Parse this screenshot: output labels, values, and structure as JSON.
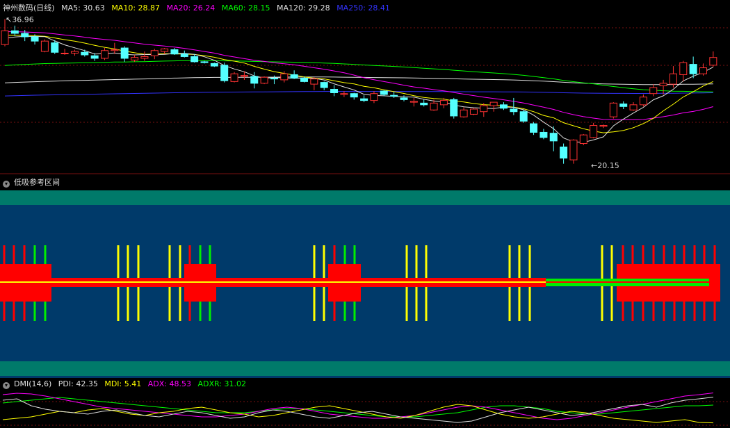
{
  "panel1": {
    "title": "神州数码(日线)",
    "indicators": [
      {
        "label": "MA5: 30.63",
        "color": "#e0e0e0"
      },
      {
        "label": "MA10: 28.87",
        "color": "#ffff00"
      },
      {
        "label": "MA20: 26.24",
        "color": "#ff00ff"
      },
      {
        "label": "MA60: 28.15",
        "color": "#00ff00"
      },
      {
        "label": "MA120: 29.28",
        "color": "#e0e0e0"
      },
      {
        "label": "MA250: 28.41",
        "color": "#3333ff"
      }
    ],
    "high_label": "36.96",
    "low_label": "20.15"
  },
  "panel2": {
    "title": "低吸参考区间"
  },
  "panel3": {
    "title": "DMI(14,6)",
    "indicators": [
      {
        "label": "PDI: 42.35",
        "color": "#e0e0e0"
      },
      {
        "label": "MDI: 5.41",
        "color": "#ffff00"
      },
      {
        "label": "ADX: 48.53",
        "color": "#ff00ff"
      },
      {
        "label": "ADXR: 31.02",
        "color": "#00ff00"
      }
    ]
  },
  "colors": {
    "up": "#ff3232",
    "down": "#54ffff",
    "grid": "#7a1010",
    "teal": "#007a6a",
    "navy": "#003a6a",
    "red": "#ff0000",
    "yellow": "#ffff00",
    "green": "#00ee00"
  },
  "chart_data": {
    "type": "candlestick",
    "candles": [
      [
        34.0,
        36.96,
        33.8,
        35.6
      ],
      [
        35.6,
        36.2,
        35.0,
        35.3
      ],
      [
        35.3,
        35.7,
        34.4,
        34.9
      ],
      [
        34.9,
        35.2,
        34.0,
        34.4
      ],
      [
        33.2,
        34.6,
        33.1,
        34.4
      ],
      [
        34.2,
        34.5,
        32.9,
        33.1
      ],
      [
        33.0,
        33.5,
        32.8,
        33.0
      ],
      [
        33.0,
        33.4,
        32.7,
        33.2
      ],
      [
        33.1,
        33.4,
        32.6,
        32.8
      ],
      [
        32.7,
        33.0,
        32.1,
        32.4
      ],
      [
        32.4,
        33.6,
        32.2,
        33.3
      ],
      [
        33.3,
        34.2,
        32.9,
        33.4
      ],
      [
        33.6,
        33.8,
        32.0,
        32.4
      ],
      [
        32.2,
        32.8,
        32.0,
        32.5
      ],
      [
        32.4,
        33.2,
        32.1,
        32.6
      ],
      [
        32.7,
        33.5,
        32.3,
        33.3
      ],
      [
        33.2,
        33.6,
        32.9,
        33.5
      ],
      [
        33.4,
        33.6,
        32.8,
        32.9
      ],
      [
        32.9,
        33.3,
        32.5,
        32.6
      ],
      [
        32.6,
        32.9,
        31.9,
        32.0
      ],
      [
        32.0,
        32.1,
        31.8,
        31.9
      ],
      [
        31.8,
        31.9,
        31.4,
        31.5
      ],
      [
        31.6,
        31.9,
        29.6,
        29.8
      ],
      [
        29.7,
        30.8,
        29.6,
        30.6
      ],
      [
        30.4,
        30.9,
        29.9,
        30.4
      ],
      [
        30.3,
        30.8,
        28.9,
        29.5
      ],
      [
        29.5,
        30.3,
        29.4,
        30.2
      ],
      [
        30.1,
        30.4,
        29.4,
        30.0
      ],
      [
        29.9,
        30.9,
        29.6,
        30.6
      ],
      [
        30.5,
        31.0,
        30.0,
        30.1
      ],
      [
        30.1,
        30.3,
        29.6,
        29.7
      ],
      [
        29.4,
        30.2,
        28.7,
        30.0
      ],
      [
        29.6,
        29.7,
        28.7,
        29.0
      ],
      [
        28.8,
        29.3,
        28.0,
        28.4
      ],
      [
        28.2,
        28.6,
        27.9,
        28.3
      ],
      [
        28.3,
        28.4,
        27.6,
        27.9
      ],
      [
        27.7,
        28.1,
        27.3,
        27.5
      ],
      [
        27.5,
        28.6,
        27.2,
        28.3
      ],
      [
        28.6,
        28.7,
        28.0,
        28.2
      ],
      [
        28.1,
        28.5,
        27.8,
        28.0
      ],
      [
        27.8,
        28.1,
        27.4,
        27.6
      ],
      [
        27.3,
        27.8,
        26.8,
        27.4
      ],
      [
        27.2,
        27.6,
        26.8,
        27.0
      ],
      [
        26.4,
        27.6,
        26.3,
        27.2
      ],
      [
        27.0,
        27.8,
        26.6,
        27.5
      ],
      [
        27.6,
        27.8,
        25.4,
        25.7
      ],
      [
        25.6,
        26.7,
        25.5,
        26.4
      ],
      [
        25.9,
        26.6,
        25.8,
        26.5
      ],
      [
        26.2,
        27.2,
        25.6,
        26.9
      ],
      [
        26.9,
        27.3,
        26.2,
        27.3
      ],
      [
        27.0,
        27.3,
        26.4,
        26.6
      ],
      [
        26.5,
        27.8,
        25.8,
        26.2
      ],
      [
        26.2,
        26.4,
        24.9,
        25.1
      ],
      [
        24.8,
        25.0,
        23.5,
        23.8
      ],
      [
        23.8,
        24.2,
        23.0,
        23.2
      ],
      [
        23.7,
        24.5,
        21.6,
        22.8
      ],
      [
        22.1,
        22.5,
        20.15,
        20.8
      ],
      [
        20.6,
        23.0,
        20.15,
        22.9
      ],
      [
        22.5,
        23.6,
        22.3,
        23.5
      ],
      [
        23.2,
        24.9,
        23.1,
        24.6
      ],
      [
        24.5,
        24.7,
        24.3,
        24.6
      ],
      [
        25.6,
        27.3,
        25.4,
        27.2
      ],
      [
        27.1,
        27.4,
        26.5,
        26.8
      ],
      [
        26.4,
        27.3,
        26.3,
        27.0
      ],
      [
        27.0,
        28.2,
        26.8,
        27.9
      ],
      [
        28.3,
        29.4,
        28.0,
        29.0
      ],
      [
        29.2,
        29.9,
        28.2,
        29.5
      ],
      [
        29.4,
        31.5,
        29.0,
        30.6
      ],
      [
        30.5,
        32.1,
        29.7,
        31.9
      ],
      [
        31.7,
        32.6,
        30.1,
        30.6
      ],
      [
        30.6,
        31.8,
        30.4,
        31.3
      ],
      [
        31.6,
        33.2,
        31.4,
        32.5
      ]
    ],
    "dmi": {
      "x": [
        0,
        1,
        2,
        3,
        4,
        5,
        6,
        7,
        8,
        9,
        10,
        11,
        12,
        13,
        14,
        15,
        16,
        17,
        18,
        19,
        20,
        21,
        22,
        23,
        24,
        25,
        26,
        27,
        28,
        29,
        30,
        31,
        32,
        33,
        34,
        35,
        36,
        37,
        38,
        39,
        40,
        41,
        42,
        43,
        44,
        45,
        46,
        47,
        48,
        49,
        50
      ],
      "pdi": [
        38,
        40,
        30,
        25,
        22,
        20,
        18,
        22,
        24,
        20,
        16,
        14,
        18,
        22,
        20,
        16,
        12,
        14,
        20,
        24,
        22,
        18,
        14,
        12,
        16,
        20,
        22,
        18,
        14,
        12,
        10,
        8,
        6,
        8,
        14,
        20,
        24,
        28,
        24,
        20,
        16,
        18,
        22,
        26,
        30,
        32,
        28,
        34,
        38,
        40,
        42.35
      ],
      "mdi": [
        10,
        12,
        14,
        18,
        22,
        20,
        24,
        26,
        22,
        18,
        16,
        20,
        22,
        26,
        28,
        24,
        20,
        18,
        14,
        16,
        20,
        24,
        28,
        30,
        26,
        22,
        18,
        14,
        12,
        16,
        22,
        28,
        32,
        30,
        24,
        18,
        14,
        12,
        14,
        18,
        22,
        20,
        16,
        12,
        10,
        8,
        6,
        8,
        10,
        6,
        5.41
      ],
      "adx": [
        46,
        48,
        47,
        44,
        40,
        36,
        32,
        28,
        26,
        24,
        22,
        20,
        18,
        16,
        14,
        14,
        16,
        18,
        22,
        26,
        28,
        26,
        22,
        18,
        16,
        14,
        12,
        12,
        14,
        16,
        20,
        24,
        28,
        30,
        28,
        24,
        20,
        16,
        12,
        10,
        12,
        16,
        20,
        24,
        28,
        32,
        36,
        40,
        44,
        46,
        48.53
      ],
      "adxr": [
        34,
        36,
        38,
        40,
        42,
        40,
        38,
        36,
        34,
        32,
        30,
        28,
        26,
        24,
        22,
        20,
        20,
        20,
        22,
        24,
        26,
        26,
        24,
        22,
        20,
        18,
        16,
        14,
        14,
        14,
        16,
        18,
        20,
        24,
        28,
        30,
        30,
        28,
        26,
        22,
        20,
        18,
        18,
        20,
        22,
        24,
        26,
        28,
        30,
        30,
        31.02
      ]
    }
  }
}
